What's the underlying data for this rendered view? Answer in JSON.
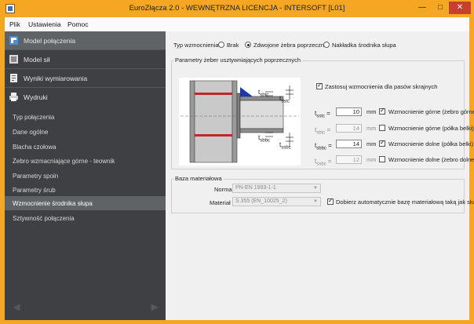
{
  "window": {
    "title": "EuroZłącza 2.0 - WEWNĘTRZNA LICENCJA - INTERSOFT [L01]",
    "minimize": "—",
    "maximize": "□",
    "close": "✕"
  },
  "menu": [
    "Plik",
    "Ustawienia",
    "Pomoc"
  ],
  "sidebar": {
    "main": [
      {
        "label": "Model połączenia",
        "icon": "connection-model-icon",
        "active": true
      },
      {
        "label": "Model sił",
        "icon": "forces-model-icon",
        "active": false
      },
      {
        "label": "Wyniki wymiarowania",
        "icon": "results-icon",
        "active": false
      },
      {
        "label": "Wydruki",
        "icon": "printer-icon",
        "active": false
      }
    ],
    "sub": [
      {
        "label": "Typ połączenia",
        "active": false
      },
      {
        "label": "Dane ogólne",
        "active": false
      },
      {
        "label": "Blacha czołowa",
        "active": false
      },
      {
        "label": "Żebro wzmacniające górne - teownik",
        "active": false
      },
      {
        "label": "Parametry spoin",
        "active": false
      },
      {
        "label": "Parametry śrub",
        "active": false
      },
      {
        "label": "Wzmocnienie środnika słupa",
        "active": true
      },
      {
        "label": "Sztywność połączenia",
        "active": false
      }
    ],
    "prev": "◀",
    "next": "▶"
  },
  "reinforcement": {
    "label": "Typ wzmocnienia",
    "options": [
      "Brak",
      "Zdwojone żebra poprzeczne",
      "Nakładka środnika słupa"
    ],
    "selected": 1
  },
  "stiffener": {
    "group_title": "Parametry żeber usztywniających poprzecznych",
    "apply_label": "Zastosuj wzmocnienia dla pasów skrajnych",
    "apply_checked": true,
    "diagram_labels": {
      "t_sbtc": "t",
      "t_sbtc_sub": "sbtc",
      "t_sstc": "t",
      "t_sstc_sub": "sstc",
      "t_sbbc": "t",
      "t_sbbc_sub": "sbbc",
      "t_ssbc": "t",
      "t_ssbc_sub": "ssbc"
    },
    "rows": [
      {
        "sym": "t",
        "sub": "sstc",
        "value": "10",
        "unit": "mm",
        "check_label": "Wzmocnienie górne (żebro górne)",
        "checked": true,
        "enabled": true
      },
      {
        "sym": "t",
        "sub": "sbtc",
        "value": "14",
        "unit": "mm",
        "check_label": "Wzmocnienie górne (półka belki)",
        "checked": false,
        "enabled": false
      },
      {
        "sym": "t",
        "sub": "sbbc",
        "value": "14",
        "unit": "mm",
        "check_label": "Wzmocnienie dolne (półka belki)",
        "checked": true,
        "enabled": true
      },
      {
        "sym": "t",
        "sub": "ssbc",
        "value": "12",
        "unit": "mm",
        "check_label": "Wzmocnienie dolne (żebro dolne)",
        "checked": false,
        "enabled": false
      }
    ]
  },
  "material": {
    "group_title": "Baza materiałowa",
    "norma_label": "Norma",
    "norma_value": "PN-EN 1993-1-1",
    "material_label": "Materiał",
    "material_value": "S 355 (EN_10025_2)",
    "auto_label": "Dobierz automatycznie bazę materiałową taką jak słup",
    "auto_checked": true
  }
}
